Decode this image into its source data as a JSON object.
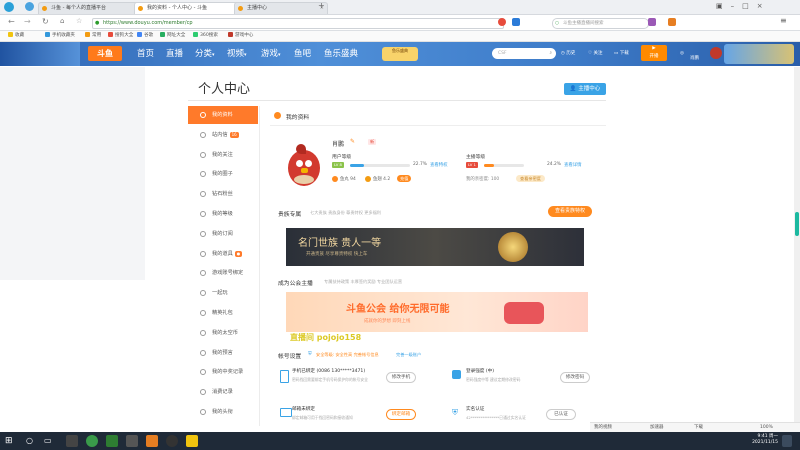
{
  "browser": {
    "tabs": [
      {
        "label": "斗鱼 - 每个人的直播平台",
        "active": false
      },
      {
        "label": "我的资料 - 个人中心 - 斗鱼",
        "active": true
      },
      {
        "label": "主播中心",
        "active": false
      }
    ],
    "url": "https://www.douyu.com/member/cp",
    "search_placeholder": "斗鱼主播直播间搜索",
    "bookmarks": [
      "收藏",
      "手机收藏夹",
      "常用",
      "搜狗大全",
      "谷歌",
      "网址大全",
      "360搜索",
      "游戏中心"
    ]
  },
  "site_nav": {
    "logo": "斗鱼",
    "items": [
      "首页",
      "直播",
      "分类",
      "视频",
      "游戏",
      "鱼吧",
      "鱼乐盛典"
    ],
    "promo": "鱼乐盛典",
    "search_placeholder": "CSF",
    "icons": [
      {
        "name": "history-icon",
        "label": "历史"
      },
      {
        "name": "follow-icon",
        "label": "关注"
      },
      {
        "name": "download-icon",
        "label": "下载"
      }
    ],
    "start_live": "开播",
    "user_label": "肖鹏"
  },
  "page": {
    "title": "个人中心",
    "anchor_center_button": "主播中心"
  },
  "sidebar": {
    "items": [
      {
        "label": "我的资料",
        "active": true
      },
      {
        "label": "站内信",
        "count": "16"
      },
      {
        "label": "我的关注"
      },
      {
        "label": "我的圈子"
      },
      {
        "label": "钻石粉丝"
      },
      {
        "label": "我的等级"
      },
      {
        "label": "我的订阅"
      },
      {
        "label": "我的道具",
        "count": "●"
      },
      {
        "label": "游戏账号绑定"
      },
      {
        "label": "一起玩"
      },
      {
        "label": "精英礼包"
      },
      {
        "label": "我的太空币"
      },
      {
        "label": "我的预言"
      },
      {
        "label": "我的中奖记录"
      },
      {
        "label": "消费记录"
      },
      {
        "label": "我的头衔"
      }
    ]
  },
  "profile": {
    "section_title": "我的资料",
    "username": "肖鹏",
    "tag": "新",
    "user_level_label": "用户等级",
    "user_level_badge": "LV 8",
    "user_level_pct": "22.7%",
    "user_level_pct_value": 0.227,
    "user_level_link": "查看特权",
    "anchor_level_label": "主播等级",
    "anchor_level_badge": "LV 1",
    "anchor_level_pct": "24.2%",
    "anchor_level_pct_value": 0.242,
    "anchor_level_link": "查看详情",
    "fish_balls": "鱼丸 94",
    "fish_wings": "鱼翅 4.2",
    "recharge": "充值",
    "activity_label": "我的亲密度: 100",
    "activity_btn": "查看亲密度"
  },
  "noble": {
    "title": "贵族专属",
    "subtitle": "七大贵族 贵族身份 尊贵特权 更多福利",
    "button": "查看贵族特权",
    "banner_title": "名门世族 贵人一等",
    "banner_sub": "开通贵族 尽享尊贵特权 快上车"
  },
  "guild": {
    "title": "成为公会主播",
    "subtitle": "专属扶持政策 丰厚签约奖励 专业团队运营",
    "banner_title": "斗鱼公会 给你无限可能",
    "banner_sub": "成就你的梦想 即刻上线",
    "watermark": "直播间 pojojo158"
  },
  "security": {
    "title": "帐号设置",
    "subtitle": "安全等级: 安全性高 完善帐号信息",
    "link": "完善一级账户",
    "items": [
      {
        "title": "手机已绑定",
        "value": "(0086 130*****3471)",
        "desc": "密码找回需要绑定手机号码保护你的帐号安全",
        "button": "修改手机"
      },
      {
        "title": "登录强度",
        "value": "(中)",
        "desc": "密码强度中等 建议定期修改密码",
        "button": "修改密码"
      },
      {
        "title": "邮箱未绑定",
        "value": "",
        "desc": "绑定邮箱可用于找回密码和接收通知",
        "button": "绑定邮箱"
      },
      {
        "title": "实名认证",
        "value": "",
        "desc": "42***************已通过实名认证",
        "button": "已认证"
      }
    ]
  },
  "statusbar": {
    "items": [
      "我的视频",
      "加速器",
      "下载",
      "100%"
    ]
  },
  "taskbar": {
    "time": "9:41 周一",
    "date": "2021/11/15"
  },
  "colors": {
    "accent": "#ff7a2a",
    "nav_blue": "#3e7cc9",
    "link_blue": "#3aa3e6"
  }
}
